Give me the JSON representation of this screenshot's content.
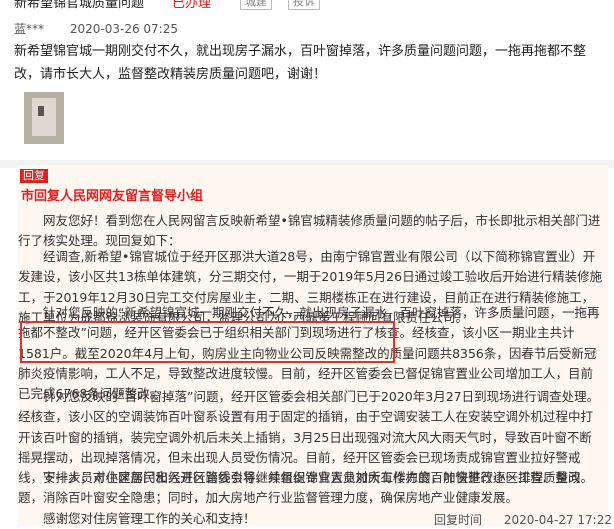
{
  "header": {
    "title": "新希望锦官城质量问题",
    "status": "已办理",
    "badges": [
      "城建",
      "投诉"
    ]
  },
  "post": {
    "author": "蓝***",
    "time": "2020-03-26 07:25",
    "body": "新希望锦官城一期刚交付不久，就出现房子漏水，百叶窗掉落，许多质量问题问题，一拖再拖都不整改，请市长大人，监督整改精装房质量问题吧，谢谢！"
  },
  "reply": {
    "tag": "回复",
    "org": "市回复人民网网友留言督导小组",
    "paragraphs": [
      "网友您好！看到您在人民网留言反映新希望•锦官城精装修质量问题的帖子后，市长即批示相关部门进行了核实处理。现回复如下：",
      "经调查,新希望•锦官城位于经开区那洪大道28号，由南宁锦官置业有限公司（以下简称锦官置业）开发建设，该小区共13栋单体建筑，分三期交付，一期于2019年5月26日通过竣工验收后开始进行精装修施工，于2019年12月30日完工交付房屋业主，二期、三期楼栋正在进行建设，目前正在进行精装修施工，施工单位为成都锦泓装饰有限公司，监理公司为广西鼎策工程顾问有限责任公司。",
      "针对您反映的“新希望锦官城一期刚交付不久，就出现房子漏水，百叶窗掉落，许多质量问题，一拖再拖都不整改”问题，经开区管委会已于组织相关部门到现场进行了核查。经核查，该小区一期业主共计1581户。截至2020年4月上旬，购房业主向物业公司反映需整改的质量问题共8356条，因春节后受新冠肺炎疫情影响，工人不足，导致整改进度较慢。目前，经开区管委会已督促锦官置业公司增加工人，目前已完成6768条问题整改。",
      "针对您反映的“百叶窗掉落”问题，经开区管委会相关部门已于2020年3月27日到现场进行调查处理。经核查，该小区的空调装饰百叶窗系设置有用于固定的插销，由于空调安装工人在安装空调外机过程中打开该百叶窗的插销，装完空调外机后未关上插销，3月25日出现强对流大风大雨天气时，导致百叶窗不断摇晃摆动，出现掉落情况，但未出现人员受伤情况。目前，经开区管委会已现场责成锦官置业拉好警戒线，安排人员对小区居民出入进行路线引导，并组织专业人员对所有楼栋的百叶窗进行逐一排查、整改。",
      "下一步，市住建部门和经开区管委会将继续督促锦官置业加大工作力度，加快整改小区工程质量问题，消除百叶窗安全隐患；同时，加大房地产行业监督管理力度，确保房地产业健康发展。",
      "感谢您对住房管理工作的关心和支持！"
    ],
    "time": "2020-04-27 17:22",
    "footer_label": "回复时间"
  }
}
